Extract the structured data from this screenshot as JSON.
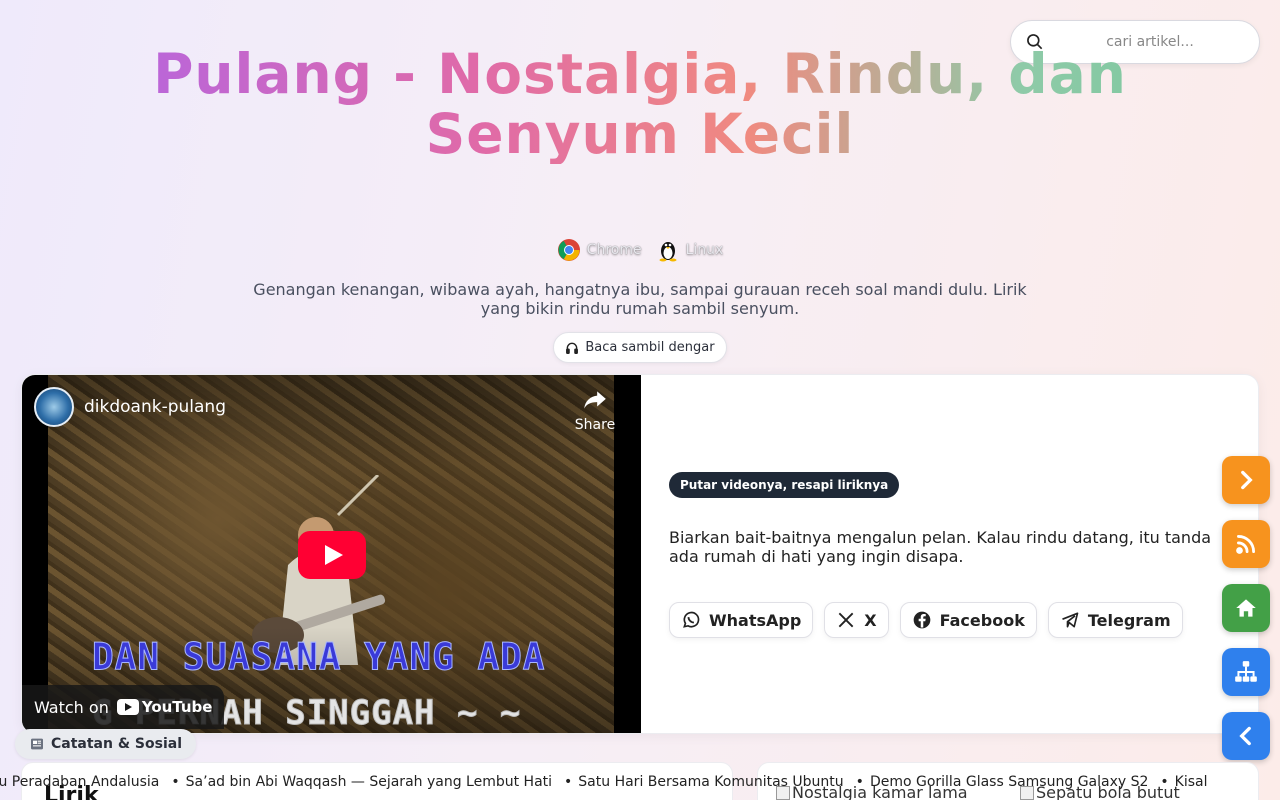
{
  "search": {
    "placeholder": "cari artikel..."
  },
  "header": {
    "title": "Pulang - Nostalgia, Rindu, dan Senyum Kecil",
    "env": [
      {
        "label": "Chrome",
        "icon": "chrome-icon"
      },
      {
        "label": "Linux",
        "icon": "linux-tux-icon"
      }
    ],
    "description": "Genangan kenangan, wibawa ayah, hangatnya ibu, sampai gurauan receh soal mandi dulu. Lirik yang bikin rindu rumah sambil senyum.",
    "listen_button": "Baca sambil dengar",
    "listen_icon": "headphones-icon"
  },
  "video": {
    "channel": "dikdoank-pulang",
    "share_label": "Share",
    "lyric_line1": "DAN SUASANA YANG ADA",
    "lyric_line2": "G PERNAH SINGGAH ~ ~",
    "watch_on": "Watch on",
    "youtube": "YouTube"
  },
  "side": {
    "pill": "Putar videonya, resapi liriknya",
    "text": "Biarkan bait-baitnya mengalun pelan. Kalau rindu datang, itu tanda ada rumah di hati yang ingin disapa.",
    "shares": [
      {
        "label": "WhatsApp",
        "icon": "whatsapp-icon"
      },
      {
        "label": "X",
        "icon": "x-icon"
      },
      {
        "label": "Facebook",
        "icon": "facebook-icon"
      },
      {
        "label": "Telegram",
        "icon": "telegram-icon"
      }
    ]
  },
  "fabs": [
    {
      "icon": "chevron-right-icon",
      "color": "#f7931e"
    },
    {
      "icon": "rss-icon",
      "color": "#f7931e"
    },
    {
      "icon": "home-icon",
      "color": "#43a047"
    },
    {
      "icon": "sitemap-icon",
      "color": "#2f80ed"
    },
    {
      "icon": "chevron-left-icon",
      "color": "#2f80ed"
    }
  ],
  "bottom": {
    "section_label": "Catatan & Sosial",
    "section_icon": "newspaper-icon",
    "lirik_heading": "Lirik",
    "images": [
      "Nostalgia kamar lama",
      "Sepatu bola butut"
    ],
    "ticker": [
      "lau Peradaban Andalusia",
      "Sa’ad bin Abi Waqqash — Sejarah yang Lembut Hati",
      "Satu Hari Bersama Komunitas Ubuntu",
      "Demo Gorilla Glass Samsung Galaxy S2",
      "Kisal"
    ]
  }
}
